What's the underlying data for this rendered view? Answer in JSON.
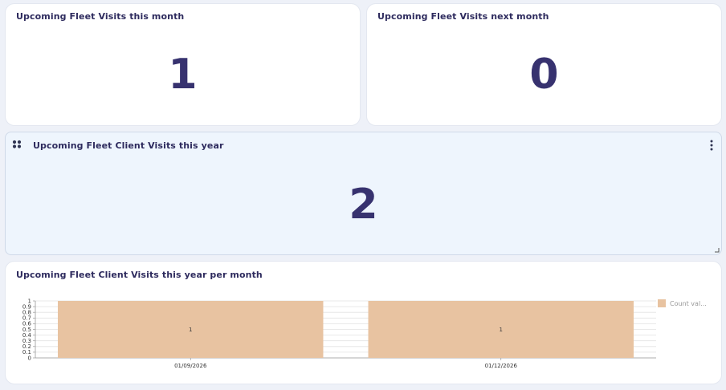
{
  "cards": {
    "this_month": {
      "title": "Upcoming Fleet Visits this month",
      "value": "1"
    },
    "next_month": {
      "title": "Upcoming Fleet Visits next month",
      "value": "0"
    },
    "this_year": {
      "title": "Upcoming Fleet Client Visits this year",
      "value": "2"
    }
  },
  "chart_card": {
    "title": "Upcoming Fleet Client Visits this year per month"
  },
  "icons": {
    "drag": "drag-handle-icon",
    "menu": "more-vertical-icon",
    "resize": "resize-corner-icon"
  },
  "colors": {
    "bar": "#e8c3a1",
    "number": "#37326f",
    "selected_card_bg": "#eef5fd"
  },
  "chart_data": {
    "type": "bar",
    "categories": [
      "01/09/2026",
      "01/12/2026"
    ],
    "series": [
      {
        "name": "Count val...",
        "values": [
          1,
          1
        ]
      }
    ],
    "data_labels": [
      "1",
      "1"
    ],
    "yticks": [
      "0",
      "0.1",
      "0.2",
      "0.3",
      "0.4",
      "0.5",
      "0.6",
      "0.7",
      "0.8",
      "0.9",
      "1"
    ],
    "ylim": [
      0,
      1
    ],
    "grid": true,
    "legend_position": "top-right"
  }
}
